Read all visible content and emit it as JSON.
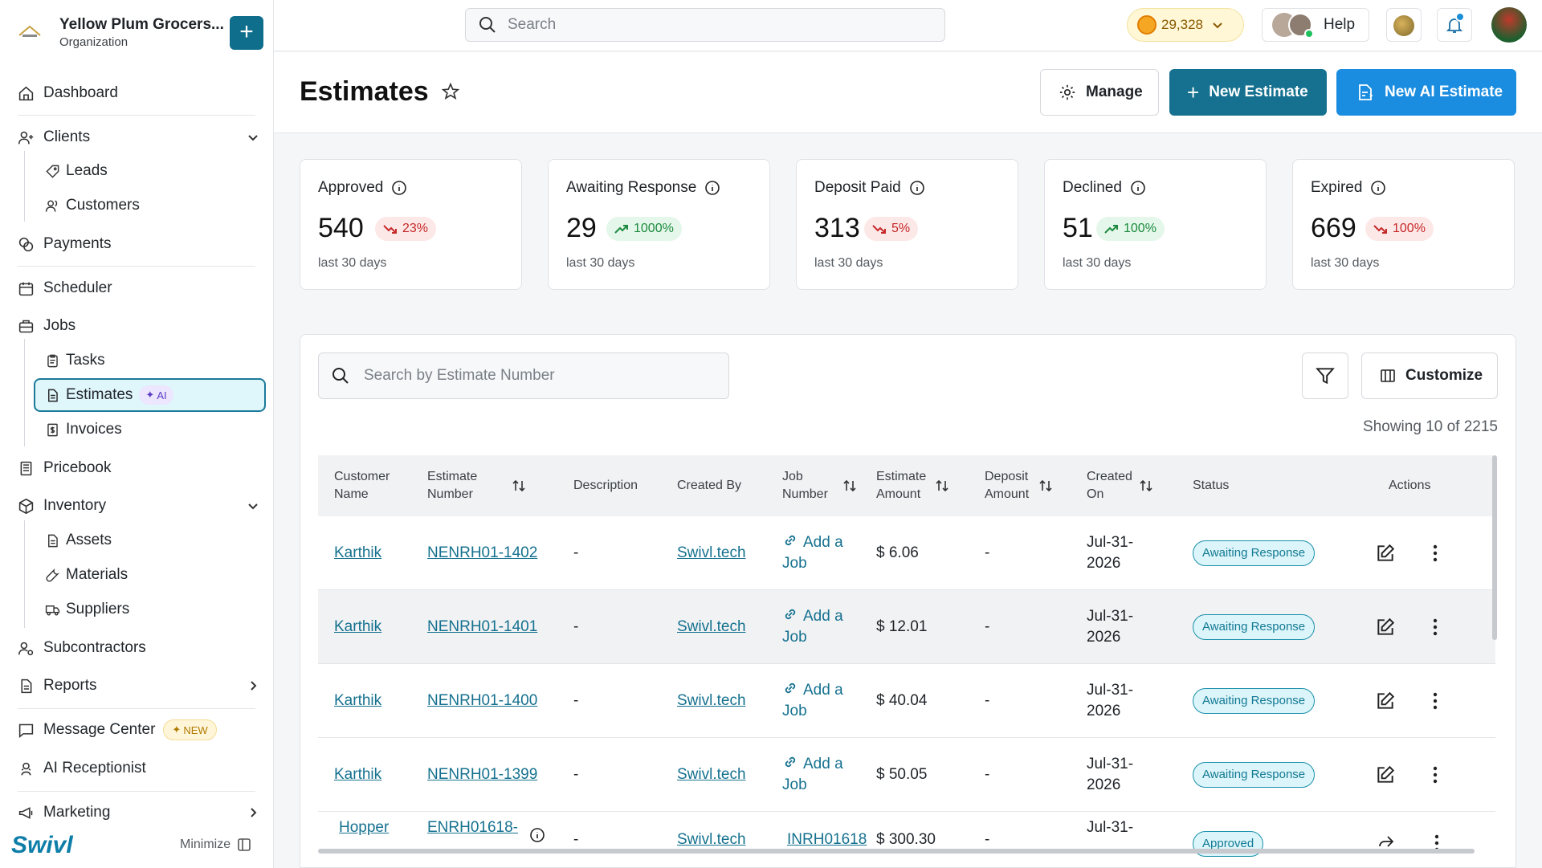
{
  "org": {
    "name": "Yellow Plum Grocers...",
    "type": "Organization",
    "add_label": "+"
  },
  "nav": {
    "dashboard": "Dashboard",
    "clients": "Clients",
    "leads": "Leads",
    "customers": "Customers",
    "payments": "Payments",
    "scheduler": "Scheduler",
    "jobs": "Jobs",
    "tasks": "Tasks",
    "estimates": "Estimates",
    "estimates_badge": "AI",
    "invoices": "Invoices",
    "pricebook": "Pricebook",
    "inventory": "Inventory",
    "assets": "Assets",
    "materials": "Materials",
    "suppliers": "Suppliers",
    "subcontractors": "Subcontractors",
    "reports": "Reports",
    "message_center": "Message Center",
    "message_badge": "NEW",
    "ai_receptionist": "AI Receptionist",
    "marketing": "Marketing"
  },
  "brand": "Swivl",
  "minimize_label": "Minimize",
  "topbar": {
    "search_placeholder": "Search",
    "coins": "29,328",
    "help": "Help"
  },
  "header": {
    "title": "Estimates",
    "manage": "Manage",
    "new_estimate": "New Estimate",
    "new_ai_estimate": "New AI Estimate"
  },
  "stats": [
    {
      "label": "Approved",
      "value": "540",
      "change": "23%",
      "trend": "down",
      "period": "last 30 days"
    },
    {
      "label": "Awaiting Response",
      "value": "29",
      "change": "1000%",
      "trend": "up",
      "period": "last 30 days"
    },
    {
      "label": "Deposit Paid",
      "value": "313",
      "change": "5%",
      "trend": "down",
      "period": "last 30 days"
    },
    {
      "label": "Declined",
      "value": "51",
      "change": "100%",
      "trend": "up",
      "period": "last 30 days"
    },
    {
      "label": "Expired",
      "value": "669",
      "change": "100%",
      "trend": "down",
      "period": "last 30 days"
    }
  ],
  "table": {
    "search_placeholder": "Search by Estimate Number",
    "customize": "Customize",
    "showing": "Showing 10 of 2215",
    "columns": {
      "customer_name": "Customer Name",
      "estimate_number": "Estimate Number",
      "description": "Description",
      "created_by": "Created By",
      "job_number": "Job Number",
      "estimate_amount": "Estimate Amount",
      "deposit_amount": "Deposit Amount",
      "created_on": "Created On",
      "status": "Status",
      "actions": "Actions"
    },
    "rows": [
      {
        "customer": "Karthik",
        "number": "NENRH01-1402",
        "description": "-",
        "created_by": "Swivl.tech",
        "job": "Add a Job",
        "amount": "$ 6.06",
        "deposit": "-",
        "created_on": "Jul-31-2026",
        "status": "Awaiting Response"
      },
      {
        "customer": "Karthik",
        "number": "NENRH01-1401",
        "description": "-",
        "created_by": "Swivl.tech",
        "job": "Add a Job",
        "amount": "$ 12.01",
        "deposit": "-",
        "created_on": "Jul-31-2026",
        "status": "Awaiting Response"
      },
      {
        "customer": "Karthik",
        "number": "NENRH01-1400",
        "description": "-",
        "created_by": "Swivl.tech",
        "job": "Add a Job",
        "amount": "$ 40.04",
        "deposit": "-",
        "created_on": "Jul-31-2026",
        "status": "Awaiting Response"
      },
      {
        "customer": "Karthik",
        "number": "NENRH01-1399",
        "description": "-",
        "created_by": "Swivl.tech",
        "job": "Add a Job",
        "amount": "$ 50.05",
        "deposit": "-",
        "created_on": "Jul-31-2026",
        "status": "Awaiting Response"
      },
      {
        "customer": "Hopper",
        "number": "ENRH01618-",
        "description": "-",
        "created_by": "Swivl.tech",
        "job": "INRH01618",
        "amount": "$ 300.30",
        "deposit": "-",
        "created_on": "Jul-31-",
        "status": "Approved"
      }
    ]
  }
}
